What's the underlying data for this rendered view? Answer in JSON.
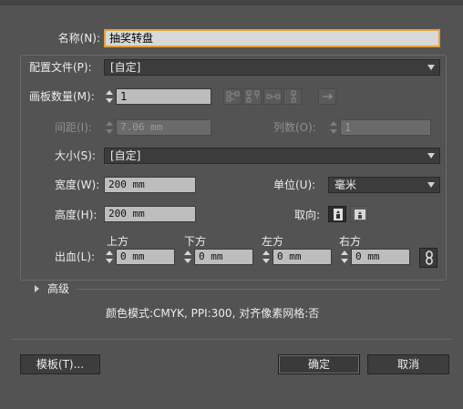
{
  "name": {
    "label": "名称(N):",
    "value": "抽奖转盘"
  },
  "profile": {
    "label": "配置文件(P):",
    "value": "[自定]"
  },
  "artboards": {
    "count_label": "画板数量(M):",
    "count_value": "1"
  },
  "spacing": {
    "label": "间距(I):",
    "value": "7.06 mm",
    "columns_label": "列数(O):",
    "columns_value": "1"
  },
  "size": {
    "label": "大小(S):",
    "value": "[自定]"
  },
  "width": {
    "label": "宽度(W):",
    "value": "200 mm"
  },
  "units": {
    "label": "单位(U):",
    "value": "毫米"
  },
  "height": {
    "label": "高度(H):",
    "value": "200 mm"
  },
  "orientation": {
    "label": "取向:"
  },
  "bleed": {
    "label": "出血(L):",
    "top_label": "上方",
    "top_value": "0 mm",
    "bottom_label": "下方",
    "bottom_value": "0 mm",
    "left_label": "左方",
    "left_value": "0 mm",
    "right_label": "右方",
    "right_value": "0 mm"
  },
  "advanced": {
    "label": "高级"
  },
  "info": "颜色模式:CMYK, PPI:300, 对齐像素网格:否",
  "buttons": {
    "templates": "模板(T)...",
    "ok": "确定",
    "cancel": "取消"
  },
  "colors": {
    "background": "#535353",
    "focus": "#e2a23b",
    "field": "#bdbdbd"
  }
}
